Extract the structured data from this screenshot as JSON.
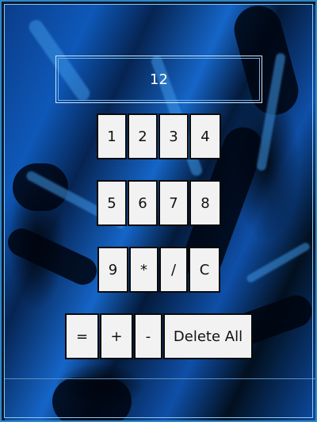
{
  "display": {
    "value": "12"
  },
  "keys": {
    "k1": "1",
    "k2": "2",
    "k3": "3",
    "k4": "4",
    "k5": "5",
    "k6": "6",
    "k7": "7",
    "k8": "8",
    "k9": "9",
    "mul": "*",
    "div": "/",
    "clear": "C",
    "eq": "=",
    "plus": "+",
    "minus": "-",
    "delete_all": "Delete All"
  }
}
